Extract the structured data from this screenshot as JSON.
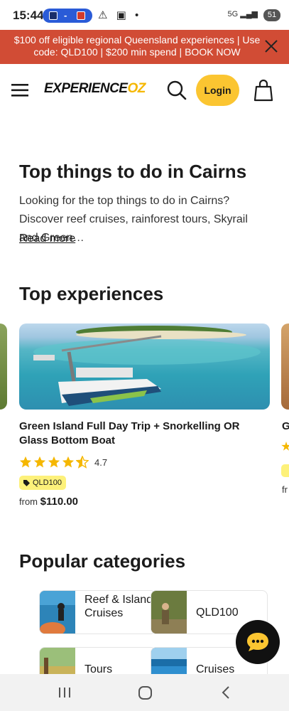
{
  "status_bar": {
    "time": "15:44",
    "battery": "51",
    "network": "5G"
  },
  "promo_banner": {
    "line1": "$100 off eligible regional Queensland experiences | Use",
    "line2": "code: QLD100 | $200 min spend | BOOK NOW",
    "background": "#d14c35"
  },
  "header": {
    "logo_main": "EXPERIENCE",
    "logo_accent": "OZ",
    "login_label": "Login",
    "login_color": "#fbc531",
    "icons": [
      "menu-icon",
      "search-icon",
      "cart-icon"
    ]
  },
  "intro": {
    "title": "Top things to do in Cairns",
    "text": "Looking for the top things to do in Cairns? Discover reef cruises, rainforest tours, Skyrail and Green…",
    "read_more": "Read more"
  },
  "experiences": {
    "title": "Top experiences",
    "cards": [
      {
        "title": "Green Island Full Day Trip + Snorkelling OR Glass Bottom Boat",
        "rating": "4.7",
        "stars": 4.5,
        "badge": "QLD100",
        "price_prefix": "from",
        "price": "$110.00"
      },
      {
        "title": "G",
        "price_prefix": "fr"
      }
    ]
  },
  "categories": {
    "title": "Popular categories",
    "items": [
      {
        "label": "Reef & Island Cruises"
      },
      {
        "label": "QLD100"
      },
      {
        "label": "Tours"
      },
      {
        "label": "Cruises"
      }
    ]
  },
  "accent_colors": {
    "star": "#f5b700",
    "badge": "#fdf17a",
    "chat_button": "#111111"
  }
}
